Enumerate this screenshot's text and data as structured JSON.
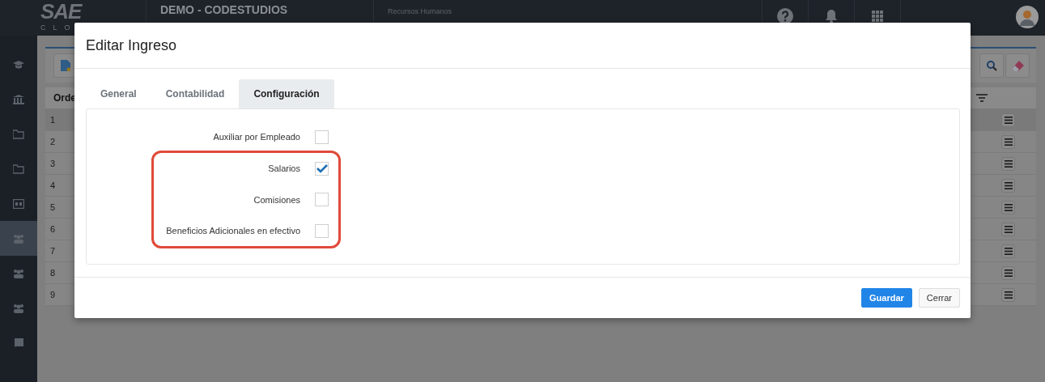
{
  "topbar": {
    "logo": "SAE",
    "logo_sub": "CLO",
    "company": "DEMO - CODESTUDIOS",
    "module": "Recursos Humanos"
  },
  "sidebar": {
    "items": [
      {
        "selected": false
      },
      {
        "selected": false
      },
      {
        "selected": false
      },
      {
        "selected": false
      },
      {
        "selected": false
      },
      {
        "selected": true
      },
      {
        "selected": false
      },
      {
        "selected": false
      },
      {
        "selected": false
      }
    ]
  },
  "table": {
    "columns": [
      "Orde"
    ],
    "rows": [
      {
        "cells": [
          "1"
        ],
        "selected": true
      },
      {
        "cells": [
          "2"
        ],
        "selected": false
      },
      {
        "cells": [
          "3"
        ],
        "selected": false
      },
      {
        "cells": [
          "4"
        ],
        "selected": false
      },
      {
        "cells": [
          "5"
        ],
        "selected": false
      },
      {
        "cells": [
          "6"
        ],
        "selected": false
      },
      {
        "cells": [
          "7"
        ],
        "selected": false
      },
      {
        "cells": [
          "8"
        ],
        "selected": false
      },
      {
        "cells": [
          "9"
        ],
        "selected": false
      }
    ]
  },
  "dialog": {
    "title": "Editar Ingreso",
    "tabs": [
      {
        "label": "General",
        "selected": false
      },
      {
        "label": "Contabilidad",
        "selected": false
      },
      {
        "label": "Configuración",
        "selected": true
      }
    ],
    "options": [
      {
        "label": "Auxiliar por Empleado",
        "checked": false,
        "highlighted": false
      },
      {
        "label": "Salarios",
        "checked": true,
        "highlighted": true
      },
      {
        "label": "Comisiones",
        "checked": false,
        "highlighted": true
      },
      {
        "label": "Beneficios Adicionales en efectivo",
        "checked": false,
        "highlighted": true
      }
    ],
    "buttons": [
      {
        "label": "Guardar",
        "kind": "primary"
      },
      {
        "label": "Cerrar",
        "kind": "secondary"
      }
    ]
  }
}
